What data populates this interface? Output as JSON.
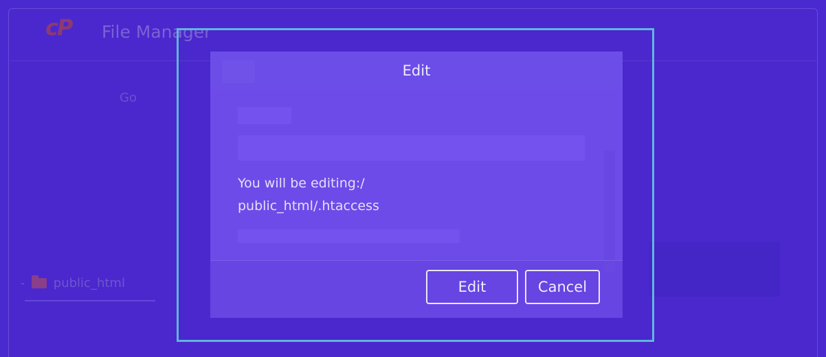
{
  "app": {
    "logo_text": "cP",
    "title": "File Manager"
  },
  "toolbar": {
    "go_label": "Go"
  },
  "tree": {
    "toggle": "-",
    "folder_label": "public_html"
  },
  "dialog": {
    "title": "Edit",
    "message_line1": "You will be editing:/",
    "message_line2": "public_html/.htaccess",
    "edit_label": "Edit",
    "cancel_label": "Cancel"
  },
  "colors": {
    "background": "#4a2ad0",
    "dialog": "#6645e2",
    "highlight_border": "#61b7dc",
    "logo": "#8d3a72"
  }
}
